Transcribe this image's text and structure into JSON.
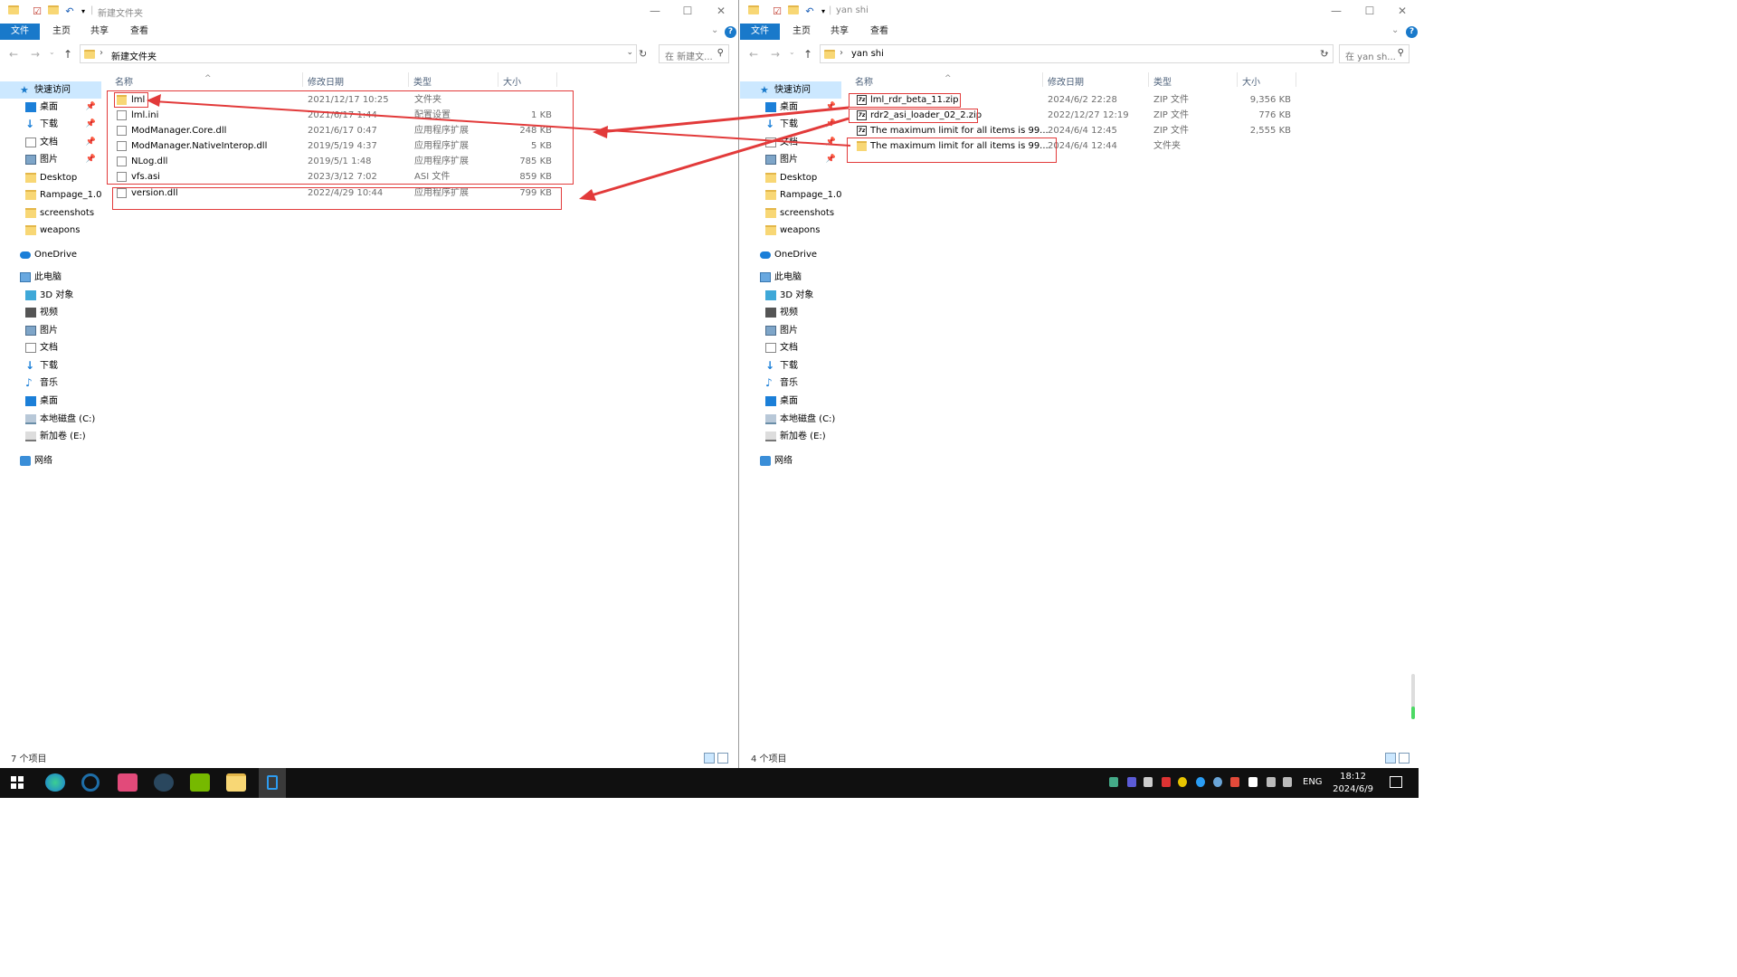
{
  "left_window": {
    "title": "新建文件夹",
    "tabs": [
      "文件",
      "主页",
      "共享",
      "查看"
    ],
    "address": "新建文件夹",
    "search_placeholder": "在 新建文...",
    "columns": [
      "名称",
      "修改日期",
      "类型",
      "大小"
    ],
    "files": [
      {
        "name": "lml",
        "date": "2021/12/17 10:25",
        "type": "文件夹",
        "size": "",
        "icon": "folder-icon"
      },
      {
        "name": "lml.ini",
        "date": "2021/6/17 1:44",
        "type": "配置设置",
        "size": "1 KB",
        "icon": "file-icon"
      },
      {
        "name": "ModManager.Core.dll",
        "date": "2021/6/17 0:47",
        "type": "应用程序扩展",
        "size": "248 KB",
        "icon": "file-icon"
      },
      {
        "name": "ModManager.NativeInterop.dll",
        "date": "2019/5/19 4:37",
        "type": "应用程序扩展",
        "size": "5 KB",
        "icon": "file-icon"
      },
      {
        "name": "NLog.dll",
        "date": "2019/5/1 1:48",
        "type": "应用程序扩展",
        "size": "785 KB",
        "icon": "file-icon"
      },
      {
        "name": "vfs.asi",
        "date": "2023/3/12 7:02",
        "type": "ASI 文件",
        "size": "859 KB",
        "icon": "file-icon"
      },
      {
        "name": "version.dll",
        "date": "2022/4/29 10:44",
        "type": "应用程序扩展",
        "size": "799 KB",
        "icon": "file-icon"
      }
    ],
    "status": "7 个项目"
  },
  "right_window": {
    "title": "yan shi",
    "tabs": [
      "文件",
      "主页",
      "共享",
      "查看"
    ],
    "address": "yan shi",
    "search_placeholder": "在 yan sh...",
    "columns": [
      "名称",
      "修改日期",
      "类型",
      "大小"
    ],
    "files": [
      {
        "name": "lml_rdr_beta_11.zip",
        "date": "2024/6/2 22:28",
        "type": "ZIP 文件",
        "size": "9,356 KB",
        "icon": "zip-icon"
      },
      {
        "name": "rdr2_asi_loader_02_2.zip",
        "date": "2022/12/27 12:19",
        "type": "ZIP 文件",
        "size": "776 KB",
        "icon": "zip-icon"
      },
      {
        "name": "The maximum limit for all items is 99...",
        "date": "2024/6/4 12:45",
        "type": "ZIP 文件",
        "size": "2,555 KB",
        "icon": "zip-icon"
      },
      {
        "name": "The maximum limit for all items is 99...",
        "date": "2024/6/4 12:44",
        "type": "文件夹",
        "size": "",
        "icon": "folder-icon"
      }
    ],
    "status": "4 个项目"
  },
  "nav_pane": {
    "quick_access": "快速访问",
    "items": [
      {
        "label": "桌面",
        "icon": "desktop-icon",
        "pinned": true
      },
      {
        "label": "下载",
        "icon": "download-icon",
        "pinned": true
      },
      {
        "label": "文档",
        "icon": "documents-icon",
        "pinned": true
      },
      {
        "label": "图片",
        "icon": "pictures-icon",
        "pinned": true
      },
      {
        "label": "Desktop",
        "icon": "folder-icon",
        "pinned": false
      },
      {
        "label": "Rampage_1.0.",
        "icon": "folder-icon",
        "pinned": false
      },
      {
        "label": "screenshots",
        "icon": "folder-icon",
        "pinned": false
      },
      {
        "label": "weapons",
        "icon": "folder-icon",
        "pinned": false
      }
    ],
    "onedrive": "OneDrive",
    "this_pc": "此电脑",
    "pc_items": [
      {
        "label": "3D 对象",
        "icon": "3d-objects-icon"
      },
      {
        "label": "视频",
        "icon": "videos-icon"
      },
      {
        "label": "图片",
        "icon": "pictures-icon"
      },
      {
        "label": "文档",
        "icon": "documents-icon"
      },
      {
        "label": "下载",
        "icon": "download-icon"
      },
      {
        "label": "音乐",
        "icon": "music-icon"
      },
      {
        "label": "桌面",
        "icon": "desktop-icon"
      },
      {
        "label": "本地磁盘 (C:)",
        "icon": "drive-c-icon"
      },
      {
        "label": "新加卷 (E:)",
        "icon": "drive-e-icon"
      }
    ],
    "network": "网络"
  },
  "taskbar": {
    "language": "ENG",
    "time": "18:12",
    "date": "2024/6/9"
  },
  "colors": {
    "accent": "#1979ca",
    "annotation_red": "#e23a3a",
    "taskbar_bg": "#101010"
  }
}
